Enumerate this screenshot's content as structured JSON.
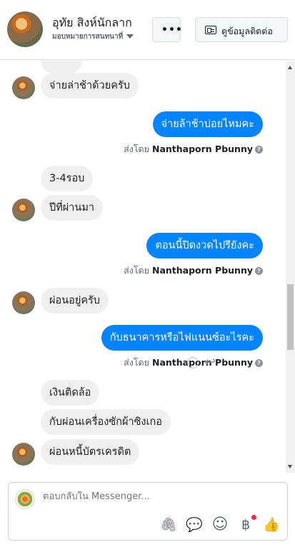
{
  "header": {
    "contact_name": "อุทัย สิงห์นักลาก",
    "role_label": "มอบหมายการสนทนาที่",
    "more_label": "•••",
    "contact_button_label": "ดูข้อมูลติดต่อ"
  },
  "thread": {
    "messages": [
      {
        "from": "customer",
        "text": "จ่ายล่าช้าด้วยครับ"
      },
      {
        "from": "page",
        "text": "จ่ายล้าช้าบ่อยไหมคะ"
      },
      {
        "from": "customer",
        "text": "3-4รอบ"
      },
      {
        "from": "customer",
        "text": "ปีที่ผ่านมา"
      },
      {
        "from": "page",
        "text": "ตอนนี้ปิดงวดไปรึยังคะ"
      },
      {
        "from": "customer",
        "text": "ผ่อนอยู่ครับ"
      },
      {
        "from": "page",
        "text": "กับธนาคารหรือไฟแนนซ์อะไรคะ"
      },
      {
        "from": "customer",
        "text": "เงินติดล้อ"
      },
      {
        "from": "customer",
        "text": "กับผ่อนเครื่องซักผ้าซิงเกอ"
      },
      {
        "from": "customer",
        "text": "ผ่อนหนี้บัตรเครดิต"
      }
    ],
    "sent_by_prefix": "ส่งโดย",
    "sent_by_name": "Nanthaporn Pbunny",
    "help_glyph": "?"
  },
  "composer": {
    "placeholder": "ตอบกลับใน Messenger...",
    "icons": [
      "paperclip-icon",
      "speech-bubble-icon",
      "emoji-icon",
      "baht-payment-icon",
      "thumbs-up-icon"
    ],
    "attach_glyph": "🖇",
    "chat_glyph": "💬",
    "emoji_glyph": "☺",
    "baht_glyph": "฿",
    "like_glyph": "👍"
  },
  "colors": {
    "outgoing_bubble": "#0084ff",
    "incoming_bubble": "#f1f0f0",
    "notification_dot": "#f02849"
  }
}
